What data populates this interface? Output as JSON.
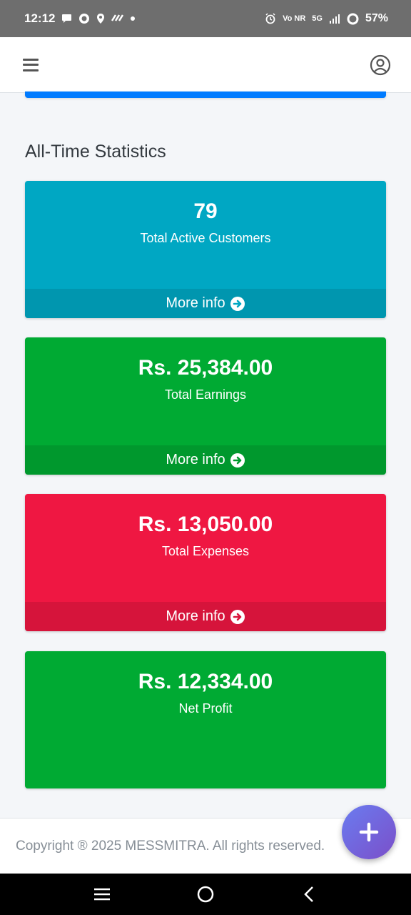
{
  "status_bar": {
    "time": "12:12",
    "network": "5G",
    "volte": "Vo NR",
    "battery": "57%",
    "icons": [
      "chat-bubble-icon",
      "whatsapp-icon",
      "location-icon",
      "app-icon",
      "dot-icon",
      "alarm-icon",
      "signal-icon",
      "battery-ring-icon"
    ]
  },
  "header": {
    "menu_icon": "hamburger-menu-icon",
    "user_icon": "user-account-icon"
  },
  "section": {
    "title": "All-Time Statistics"
  },
  "cards": [
    {
      "value": "79",
      "label": "Total Active Customers",
      "footer": "More info",
      "color": "#00a7c3"
    },
    {
      "value": "Rs. 25,384.00",
      "label": "Total Earnings",
      "footer": "More info",
      "color": "#00aa33"
    },
    {
      "value": "Rs. 13,050.00",
      "label": "Total Expenses",
      "footer": "More info",
      "color": "#ef1742"
    },
    {
      "value": "Rs. 12,334.00",
      "label": "Net Profit",
      "color": "#00aa33"
    }
  ],
  "footer": {
    "copyright": "Copyright ® 2025 MESSMITRA. All rights reserved."
  },
  "fab": {
    "icon": "plus-icon"
  },
  "nav_bar": {
    "icons": [
      "recent-apps-icon",
      "home-icon",
      "back-icon"
    ]
  }
}
